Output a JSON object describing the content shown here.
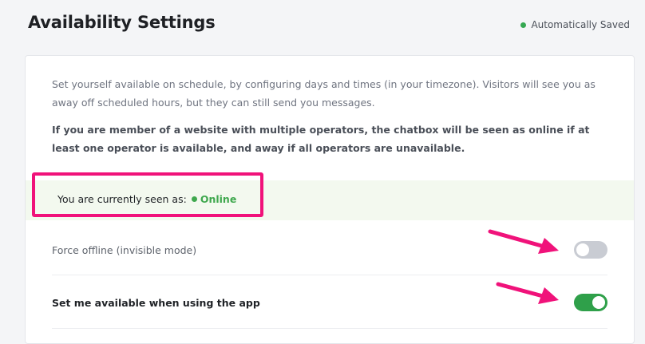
{
  "header": {
    "title": "Availability Settings",
    "save_status": "Automatically Saved",
    "save_status_color": "#36a852"
  },
  "card": {
    "description": "Set yourself available on schedule, by configuring days and times (in your timezone). Visitors will see you as away off scheduled hours, but they can still send you messages.",
    "note": "If you are member of a website with multiple operators, the chatbox will be seen as online if at least one operator is available, and away if all operators are unavailable.",
    "status": {
      "label": "You are currently seen as:",
      "value": "Online",
      "value_color": "#3fa84e"
    },
    "settings": [
      {
        "label": "Force offline (invisible mode)",
        "enabled": false
      },
      {
        "label": "Set me available when using the app",
        "enabled": true
      }
    ]
  },
  "annotations": {
    "highlight_color": "#f0127a",
    "arrow_color": "#f0127a",
    "icons": [
      "status-dot-icon",
      "arrow-pointer-icon"
    ]
  }
}
